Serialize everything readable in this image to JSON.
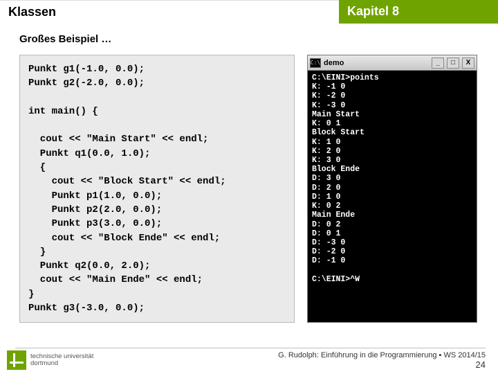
{
  "header": {
    "left": "Klassen",
    "right": "Kapitel 8"
  },
  "subtitle": "Großes Beispiel …",
  "code": "Punkt g1(-1.0, 0.0);\nPunkt g2(-2.0, 0.0);\n\nint main() {\n\n  cout << \"Main Start\" << endl;\n  Punkt q1(0.0, 1.0);\n  {\n    cout << \"Block Start\" << endl;\n    Punkt p1(1.0, 0.0);\n    Punkt p2(2.0, 0.0);\n    Punkt p3(3.0, 0.0);\n    cout << \"Block Ende\" << endl;\n  }\n  Punkt q2(0.0, 2.0);\n  cout << \"Main Ende\" << endl;\n}\nPunkt g3(-3.0, 0.0);",
  "console": {
    "icon_text": "C:\\",
    "title": "demo",
    "min": "_",
    "max": "□",
    "close": "X",
    "output": "C:\\EINI>points\nK: -1 0\nK: -2 0\nK: -3 0\nMain Start\nK: 0 1\nBlock Start\nK: 1 0\nK: 2 0\nK: 3 0\nBlock Ende\nD: 3 0\nD: 2 0\nD: 1 0\nK: 0 2\nMain Ende\nD: 0 2\nD: 0 1\nD: -3 0\nD: -2 0\nD: -1 0\n\nC:\\EINI>^W"
  },
  "footer": {
    "uni_line1": "technische universität",
    "uni_line2": "dortmund",
    "credit": "G. Rudolph: Einführung in die Programmierung ▪ WS 2014/15",
    "page": "24"
  }
}
